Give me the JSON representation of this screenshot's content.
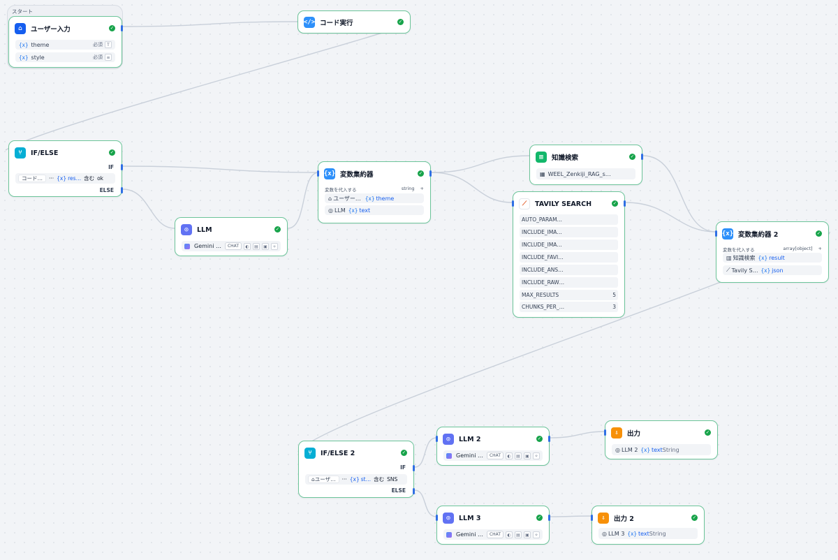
{
  "start_group_label": "スタート",
  "nodes": {
    "user_input": {
      "title": "ユーザー入力",
      "icon": "home-icon",
      "vars": [
        {
          "name": "theme",
          "req": "必須"
        },
        {
          "name": "style",
          "req": "必須"
        }
      ]
    },
    "code_exec": {
      "title": "コード実行",
      "icon": "code-icon"
    },
    "ifelse1": {
      "title": "IF/ELSE",
      "icon": "branch-icon",
      "if_label": "IF",
      "else_label": "ELSE",
      "cond_lhs": "コード…",
      "cond_dots": "···",
      "cond_var": "res…",
      "cond_op": "含む",
      "cond_val": "ok"
    },
    "llm1": {
      "title": "LLM",
      "icon": "brain-icon",
      "model": "Gemini …",
      "mode": "CHAT"
    },
    "aggr1": {
      "title": "変数集約器",
      "icon": "variable-icon",
      "assign_label": "変数を代入する",
      "type": "string",
      "rows": [
        {
          "src": "ユーザー…",
          "var": "theme"
        },
        {
          "src": "LLM",
          "var": "text"
        }
      ]
    },
    "knowledge": {
      "title": "知識検索",
      "icon": "book-icon",
      "dataset": "WEEL_Zenkiji_RAG_s…"
    },
    "tavily": {
      "title": "TAVILY SEARCH",
      "icon": "tavily-icon",
      "params": [
        {
          "name": "AUTO_PARAM…",
          "value": ""
        },
        {
          "name": "INCLUDE_IMA…",
          "value": ""
        },
        {
          "name": "INCLUDE_IMA…",
          "value": ""
        },
        {
          "name": "INCLUDE_FAVI…",
          "value": ""
        },
        {
          "name": "INCLUDE_ANS…",
          "value": ""
        },
        {
          "name": "INCLUDE_RAW…",
          "value": ""
        },
        {
          "name": "MAX_RESULTS",
          "value": "5"
        },
        {
          "name": "CHUNKS_PER_…",
          "value": "3"
        }
      ]
    },
    "aggr2": {
      "title": "変数集約器 2",
      "icon": "variable-icon",
      "assign_label": "変数を代入する",
      "type": "array[object]",
      "rows": [
        {
          "src": "知識検索",
          "var": "result"
        },
        {
          "src": "Tavily S…",
          "var": "json"
        }
      ]
    },
    "ifelse2": {
      "title": "IF/ELSE 2",
      "icon": "branch-icon",
      "if_label": "IF",
      "else_label": "ELSE",
      "cond_lhs": "ユーザ…",
      "cond_dots": "···",
      "cond_var": "st…",
      "cond_op": "含む",
      "cond_val": "SNS"
    },
    "llm2": {
      "title": "LLM 2",
      "icon": "brain-icon",
      "model": "Gemini …",
      "mode": "CHAT"
    },
    "llm3": {
      "title": "LLM 3",
      "icon": "brain-icon",
      "model": "Gemini …",
      "mode": "CHAT"
    },
    "out1": {
      "title": "出力",
      "icon": "output-icon",
      "src": "LLM 2",
      "var": "text",
      "type": "String"
    },
    "out2": {
      "title": "出力 2",
      "icon": "output-icon",
      "src": "LLM 3",
      "var": "text",
      "type": "String"
    }
  }
}
